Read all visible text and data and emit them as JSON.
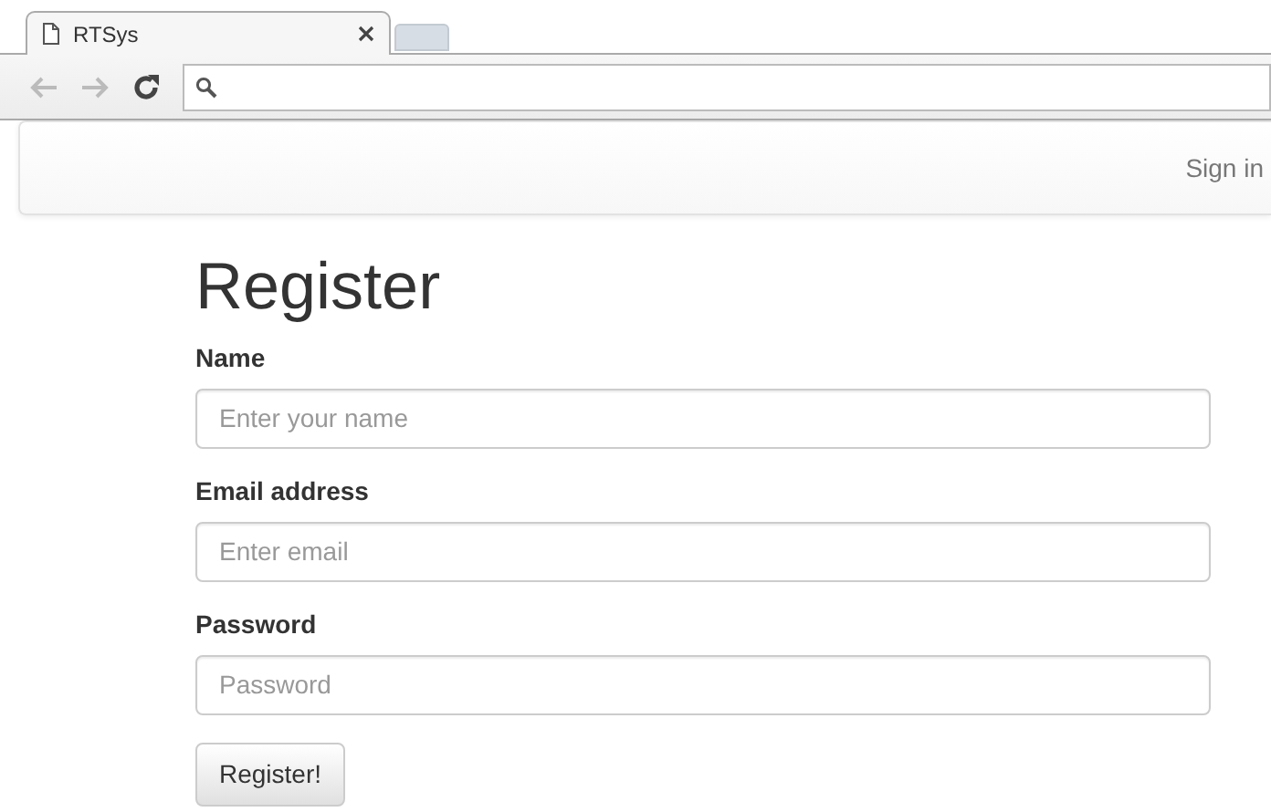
{
  "browser": {
    "tabs": [
      {
        "title": "RTSys",
        "selected": true,
        "kind": "page"
      },
      {
        "selected": false,
        "kind": "new"
      }
    ]
  },
  "navbar": {
    "links": [
      "Sign in"
    ]
  },
  "form": {
    "heading": "Register",
    "fields": [
      {
        "label": "Name",
        "placeholder": "Enter your name"
      },
      {
        "label": "Email address",
        "placeholder": "Enter email"
      },
      {
        "label": "Password",
        "placeholder": "Password"
      }
    ],
    "button": "Register!"
  }
}
